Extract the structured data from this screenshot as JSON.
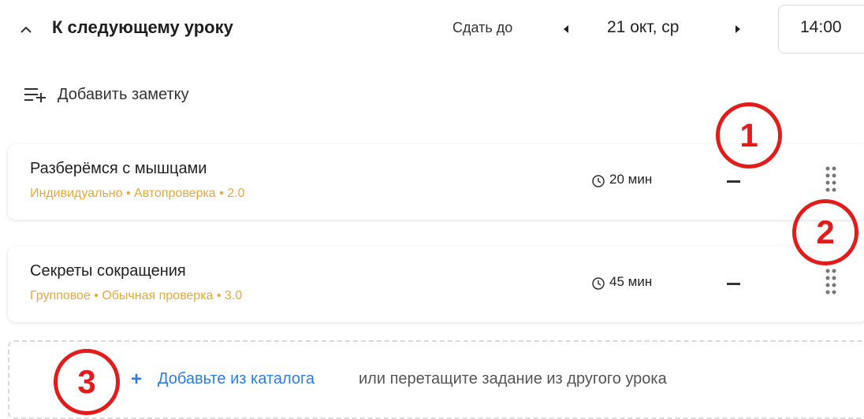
{
  "header": {
    "title": "К следующему уроку",
    "due_label": "Сдать до",
    "date": "21 окт, ср",
    "time": "14:00"
  },
  "add_note": {
    "label": "Добавить заметку"
  },
  "tasks": [
    {
      "title": "Разберёмся с мышцами",
      "meta": "Индивидуально • Автопроверка • 2.0",
      "duration": "20 мин"
    },
    {
      "title": "Секреты сокращения",
      "meta": "Групповое • Обычная проверка • 3.0",
      "duration": "45 мин"
    }
  ],
  "dropzone": {
    "link": "Добавьте из каталога",
    "text": "или перетащите задание из другого урока"
  },
  "annotations": [
    "1",
    "2",
    "3"
  ],
  "colors": {
    "meta": "#e5a93a",
    "link": "#2a7de1",
    "annotation": "#e31b1b"
  },
  "icons": [
    "chevron-up-icon",
    "caret-left-icon",
    "caret-right-icon",
    "add-note-icon",
    "clock-icon",
    "minus-icon",
    "drag-handle-icon",
    "plus-icon"
  ]
}
